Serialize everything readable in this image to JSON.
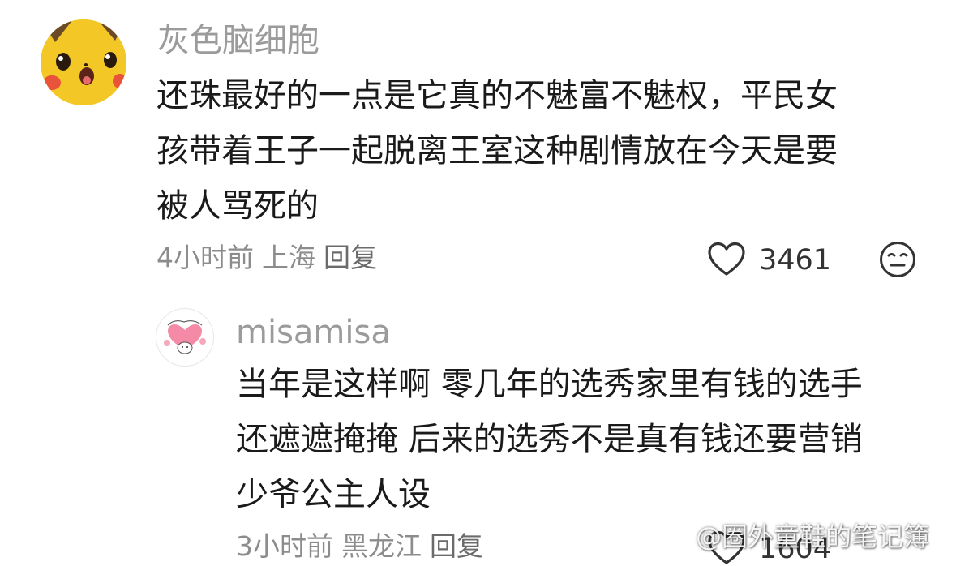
{
  "comments": [
    {
      "username": "灰色脑细胞",
      "avatar": "pikachu-avatar",
      "body_lines": [
        "还珠最好的一点是它真的不魅富不魅权，平民女",
        "孩带着王子一起脱离王室这种剧情放在今天是要",
        "被人骂死的"
      ],
      "time": "4小时前",
      "location": "上海",
      "reply_label": "回复",
      "like_count": "3461"
    },
    {
      "username": "misamisa",
      "avatar": "pink-heart-bear-avatar",
      "body_lines": [
        "当年是这样啊 零几年的选秀家里有钱的选手",
        "还遮遮掩掩 后来的选秀不是真有钱还要营销",
        "少爷公主人设"
      ],
      "time": "3小时前",
      "location": "黑龙江",
      "reply_label": "回复",
      "like_count": "1604"
    }
  ],
  "watermark": "@圈外童鞋的笔记簿",
  "colors": {
    "username": "#9b9b9b",
    "body": "#1a1a1a",
    "meta": "#8c8c8c",
    "icon": "#333333",
    "pikachu_yellow": "#f3c726"
  }
}
